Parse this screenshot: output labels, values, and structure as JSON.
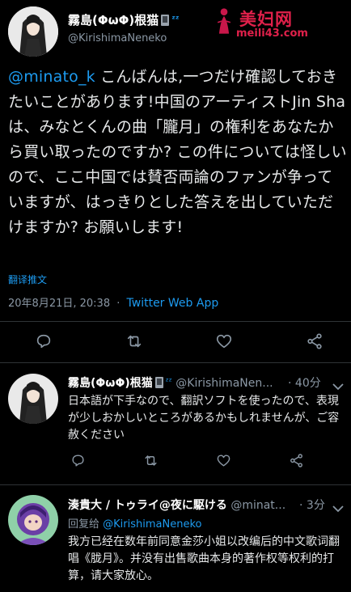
{
  "header": {
    "display_name": "霧島(ΦωΦ)根猫",
    "handle": "@KirishimaNeneko",
    "sleep_badge": "ᶻᶻ"
  },
  "watermark": {
    "title": "美妇网",
    "url": "meili43.com",
    "color": "#e0204a"
  },
  "tweet": {
    "mention": "@minato_k",
    "body": " こんばんは,一つだけ確認しておきたいことがあります!中国のアーティストJin Shaは、みなとくんの曲「朧月」の権利をあなたから買い取ったのですか? この件については怪しいので、ここ中国では賛否両論のファンが争っていますが、はっきりとした答えを出していただけますか? お願いします!",
    "translate_label": "翻译推文",
    "timestamp": "20年8月21日, 20:38",
    "separator": "·",
    "source": "Twitter Web App"
  },
  "actions": {
    "icons": [
      "reply-icon",
      "retweet-icon",
      "like-icon",
      "share-icon"
    ]
  },
  "replies": [
    {
      "name": "霧島(ΦωΦ)根猫",
      "handle": "@KirishimaNen...",
      "sep": "·",
      "time": "40分",
      "text": "日本語が下手なので、翻訳ソフトを使ったので、表現が少しおかしいところがあるかもしれませんが、ご容赦ください"
    },
    {
      "name": "湊貴大 / トゥライ@夜に駆ける",
      "handle": "@minat...",
      "sep": "·",
      "time": "3分",
      "reply_prefix": "回复给 ",
      "reply_to": "@KirishimaNeneko",
      "text": "我方已经在数年前同意金莎小姐以改编后的中文歌词翻唱《胧月》。并没有出售歌曲本身的著作权等权利的打算，请大家放心。"
    }
  ],
  "colors": {
    "accent": "#1d9bf0",
    "muted": "#8b98a5",
    "background": "#000000"
  }
}
